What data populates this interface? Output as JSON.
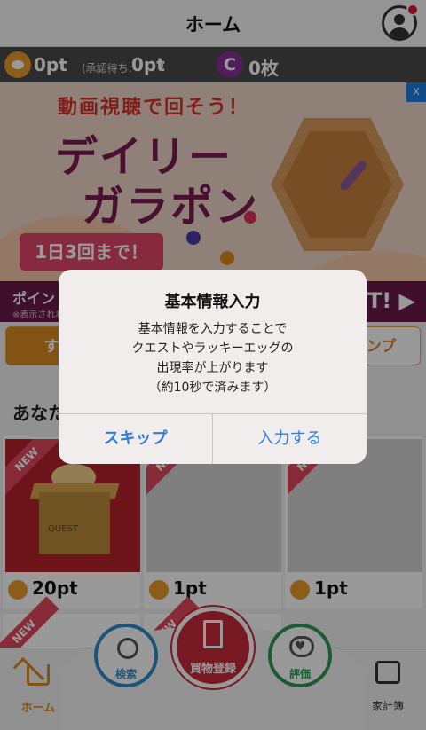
{
  "header": {
    "title": "ホーム"
  },
  "points": {
    "balance": "0pt",
    "pending_label": "(承認待ち:",
    "pending_value": "0pt",
    "pending_close": ")",
    "coin_symbol": "C",
    "coin_count": "0枚"
  },
  "banner": {
    "headline": "動画視聴で回そう！",
    "title_line1": "デイリー",
    "title_line2": "ガラポン",
    "limit": "1日3回まで！",
    "ad_badge": "X"
  },
  "point_bar": {
    "lead": "ポイン",
    "note": "※表示されれ",
    "tail": "T! ▶"
  },
  "tabs": [
    {
      "label": "すべ"
    },
    {
      "label": "タンプ"
    }
  ],
  "section_title": "あなた",
  "cards": [
    {
      "badge": "NEW",
      "points": "20pt",
      "image_label": "QUEST"
    },
    {
      "badge": "NEW",
      "points": "1pt"
    },
    {
      "badge": "NEW",
      "points": "1pt"
    }
  ],
  "cards_row2": [
    {
      "badge": "NEW"
    },
    {
      "badge": "NEW"
    }
  ],
  "bottom_nav": {
    "home": "ホーム",
    "search": "検索",
    "register": "買物登録",
    "review": "評価",
    "kakeibo": "家計簿"
  },
  "dialog": {
    "title": "基本情報入力",
    "message": [
      "基本情報を入力することで",
      "クエストやラッキーエッグの",
      "出現率が上がります",
      "（約10秒で済みます）"
    ],
    "skip": "スキップ",
    "enter": "入力する"
  },
  "colors": {
    "accent": "#d98a1f",
    "dialog_button": "#2f7de0",
    "register": "#c92a3a",
    "search": "#2f8ac9",
    "review": "#2e9a52"
  }
}
